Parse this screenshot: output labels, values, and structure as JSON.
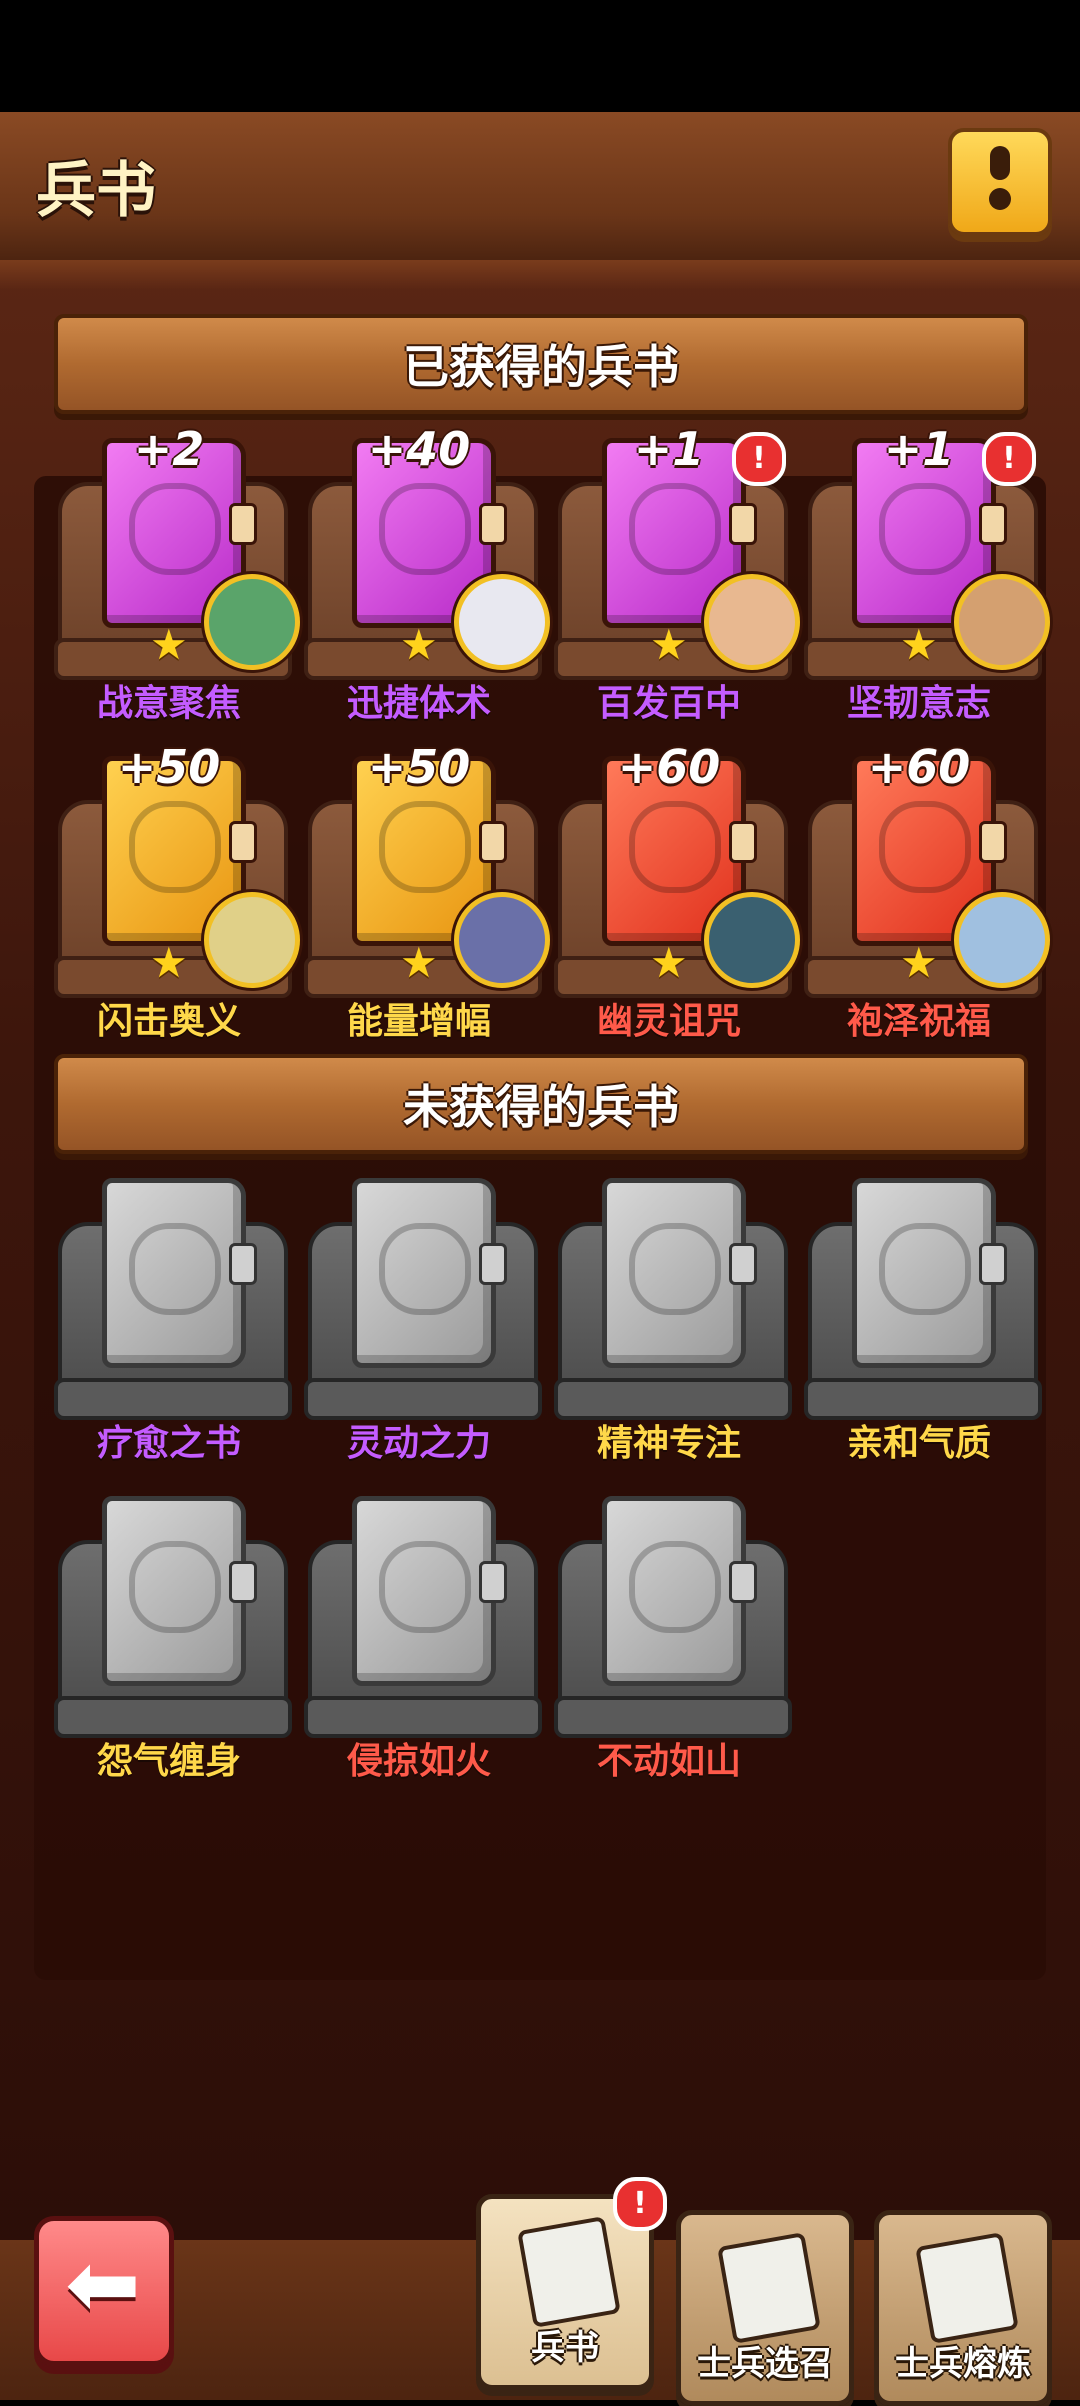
{
  "header": {
    "title": "兵书"
  },
  "sections": {
    "acquired": "已获得的兵书",
    "not_acquired": "未获得的兵书"
  },
  "acquired_books": [
    {
      "name": "战意聚焦",
      "level": "+2",
      "tier": "purple",
      "name_color": "#c45cff",
      "alert": false,
      "avatar_color": "#5aa46a"
    },
    {
      "name": "迅捷体术",
      "level": "+40",
      "tier": "purple",
      "name_color": "#c45cff",
      "alert": false,
      "avatar_color": "#e8e8f0"
    },
    {
      "name": "百发百中",
      "level": "+1",
      "tier": "purple",
      "name_color": "#c45cff",
      "alert": true,
      "avatar_color": "#e8b890"
    },
    {
      "name": "坚韧意志",
      "level": "+1",
      "tier": "purple",
      "name_color": "#c45cff",
      "alert": true,
      "avatar_color": "#d4a070"
    },
    {
      "name": "闪击奥义",
      "level": "+50",
      "tier": "gold",
      "name_color": "#ffd84a",
      "alert": false,
      "avatar_color": "#e0d088"
    },
    {
      "name": "能量增幅",
      "level": "+50",
      "tier": "gold",
      "name_color": "#ffd84a",
      "alert": false,
      "avatar_color": "#6a70a8"
    },
    {
      "name": "幽灵诅咒",
      "level": "+60",
      "tier": "red",
      "name_color": "#ff5a4a",
      "alert": false,
      "avatar_color": "#3a6070"
    },
    {
      "name": "袍泽祝福",
      "level": "+60",
      "tier": "red",
      "name_color": "#ff5a4a",
      "alert": false,
      "avatar_color": "#a0c0e0"
    }
  ],
  "locked_books": [
    {
      "name": "疗愈之书",
      "name_color": "#c45cff"
    },
    {
      "name": "灵动之力",
      "name_color": "#c45cff"
    },
    {
      "name": "精神专注",
      "name_color": "#ffd84a"
    },
    {
      "name": "亲和气质",
      "name_color": "#ffd84a"
    },
    {
      "name": "怨气缠身",
      "name_color": "#ffd84a"
    },
    {
      "name": "侵掠如火",
      "name_color": "#ff5a4a"
    },
    {
      "name": "不动如山",
      "name_color": "#ff5a4a"
    }
  ],
  "alert_glyph": "!",
  "star_glyph": "★",
  "back_glyph": "⬅",
  "bottom_nav": [
    {
      "label": "兵书",
      "active": true,
      "alert": true
    },
    {
      "label": "士兵选召",
      "active": false,
      "alert": false
    },
    {
      "label": "士兵熔炼",
      "active": false,
      "alert": false
    }
  ]
}
